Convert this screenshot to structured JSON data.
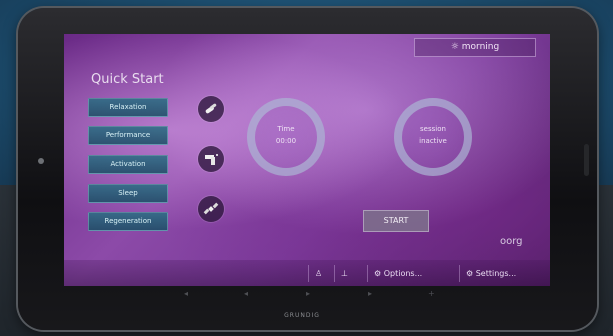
{
  "status": {
    "label": "morning",
    "icon": "sun-icon"
  },
  "quick_start": {
    "title": "Quick Start",
    "buttons": [
      "Relaxation",
      "Performance",
      "Activation",
      "Sleep",
      "Regeneration"
    ],
    "icons": [
      "pills-icon",
      "spray-icon",
      "satellite-icon"
    ]
  },
  "timer": {
    "label": "Time",
    "value": "00:00"
  },
  "session": {
    "label": "session",
    "value": "inactive"
  },
  "start_label": "START",
  "logo": "oorg",
  "bottom_bar": {
    "icon_a": "figure-icon",
    "icon_b": "bed-icon",
    "options_label": "Options...",
    "settings_label": "Settings..."
  },
  "brand": "GRUNDIG"
}
